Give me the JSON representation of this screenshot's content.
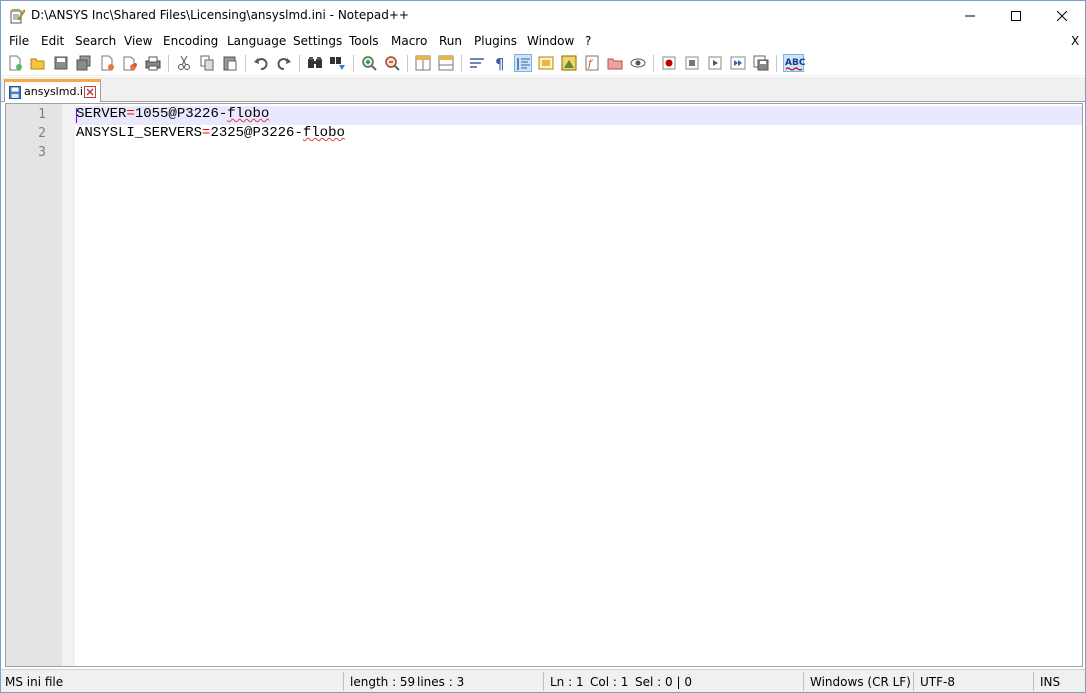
{
  "window": {
    "title": "D:\\ANSYS Inc\\Shared Files\\Licensing\\ansyslmd.ini - Notepad++"
  },
  "menu": {
    "items": [
      "File",
      "Edit",
      "Search",
      "View",
      "Encoding",
      "Language",
      "Settings",
      "Tools",
      "Macro",
      "Run",
      "Plugins",
      "Window",
      "?"
    ],
    "close_doc": "X"
  },
  "toolbar": {
    "icons": [
      "new-file-icon",
      "open-file-icon",
      "save-icon",
      "save-all-icon",
      "close-icon",
      "close-all-icon",
      "print-icon",
      "cut-icon",
      "copy-icon",
      "paste-icon",
      "undo-icon",
      "redo-icon",
      "find-icon",
      "replace-icon",
      "zoom-in-icon",
      "zoom-out-icon",
      "sync-vertical-icon",
      "sync-horizontal-icon",
      "word-wrap-icon",
      "show-all-chars-icon",
      "indent-guide-icon",
      "user-lang-icon",
      "doc-map-icon",
      "function-list-icon",
      "folder-workspace-icon",
      "monitoring-icon",
      "macro-record-icon",
      "macro-stop-icon",
      "macro-play-icon",
      "macro-run-multiple-icon",
      "macro-save-icon",
      "spell-check-icon"
    ],
    "spell_check_label": "ABC"
  },
  "tabs": [
    {
      "label": "ansyslmd.ini",
      "active": true
    }
  ],
  "editor": {
    "lines": [
      {
        "number": "1",
        "key": "SERVER",
        "op": "=",
        "value_plain": "1055@P3226-",
        "value_misspelled": "flobo"
      },
      {
        "number": "2",
        "key": "ANSYSLI_SERVERS",
        "op": "=",
        "value_plain": "2325@P3226-",
        "value_misspelled": "flobo"
      },
      {
        "number": "3",
        "key": "",
        "op": "",
        "value_plain": "",
        "value_misspelled": ""
      }
    ]
  },
  "statusbar": {
    "file_type": "MS ini file",
    "length": "length : 59",
    "lines": "lines : 3",
    "ln": "Ln : 1",
    "col": "Col : 1",
    "sel": "Sel : 0 | 0",
    "eol": "Windows (CR LF)",
    "encoding": "UTF-8",
    "mode": "INS"
  },
  "colors": {
    "tab_accent": "#f6a94b",
    "operator": "#ff0000",
    "current_line": "#e8e8ff",
    "gutter": "#e4e4e4",
    "caret": "#8000ff"
  }
}
